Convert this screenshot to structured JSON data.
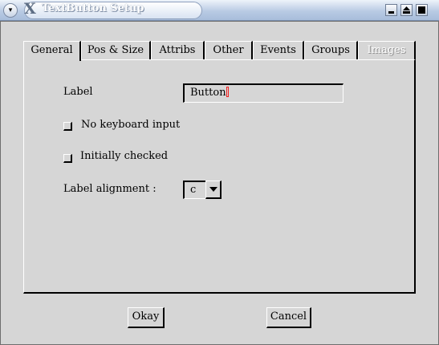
{
  "window": {
    "title": "TextButton Setup",
    "menu_glyph": "▾"
  },
  "tabs": [
    {
      "label": "General",
      "active": true
    },
    {
      "label": "Pos & Size"
    },
    {
      "label": "Attribs"
    },
    {
      "label": "Other"
    },
    {
      "label": "Events"
    },
    {
      "label": "Groups"
    },
    {
      "label": "Images",
      "disabled": true
    }
  ],
  "general": {
    "label_caption": "Label",
    "label_value": "Button",
    "no_keyboard_label": "No keyboard input",
    "no_keyboard_checked": false,
    "initially_checked_label": "Initially checked",
    "initially_checked_checked": false,
    "alignment_caption": "Label alignment :",
    "alignment_value": "c"
  },
  "buttons": {
    "ok": "Okay",
    "cancel": "Cancel"
  }
}
